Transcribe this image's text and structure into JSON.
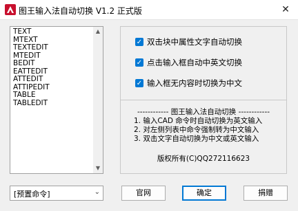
{
  "window": {
    "title": "图王输入法自动切换 V1.2 正式版",
    "close_glyph": "✕",
    "app_icon": "autocad-a-icon"
  },
  "command_list": {
    "items": [
      "TEXT",
      "MTEXT",
      "TEXTEDIT",
      "MTEDIT",
      "BEDIT",
      "EATTEDIT",
      "ATTEDIT",
      "ATTIPEDIT",
      "TABLE",
      "TABLEDIT"
    ],
    "scroll_up_glyph": "▲",
    "scroll_down_glyph": "▼"
  },
  "options": [
    {
      "label": "双击块中属性文字自动切换",
      "checked": true
    },
    {
      "label": "点击输入框自动中英文切换",
      "checked": true
    },
    {
      "label": "输入框无内容时切换为中文",
      "checked": true
    }
  ],
  "info": {
    "title": "------------ 图王输入法自动切换 ------------",
    "lines": [
      "1. 输入CAD 命令时自动切换为英文输入",
      "2. 对左侧列表中命令强制转为中文输入",
      "3. 双击文字自动切换为中文或英文输入"
    ],
    "copyright": "版权所有(C)QQ272116623"
  },
  "preset_combo": {
    "value": "[预置命令]",
    "arrow_glyph": "⌄"
  },
  "buttons": {
    "website": "官网",
    "ok": "确定",
    "donate": "捐赠"
  },
  "colors": {
    "accent": "#0078d4",
    "icon_red": "#c8102e"
  }
}
